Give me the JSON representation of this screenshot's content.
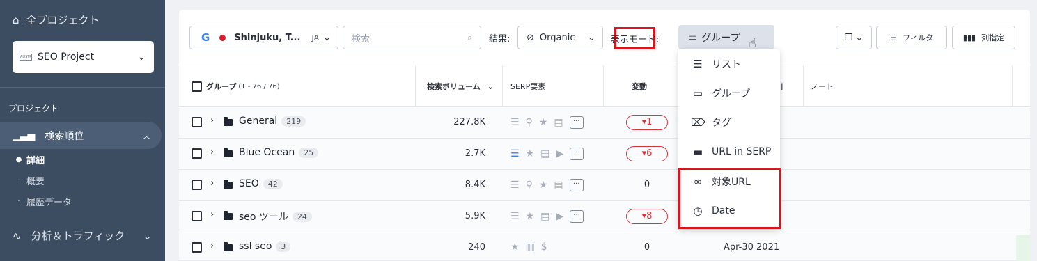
{
  "sidebar": {
    "all_projects": "全プロジェクト",
    "project_name": "SEO Project",
    "project_logo_text": "AUSTRO",
    "section_label": "プロジェクト",
    "active_item": "検索順位",
    "sub_items": [
      "詳細",
      "概要",
      "履歴データ"
    ],
    "bottom_item": "分析＆トラフィック"
  },
  "toolbar": {
    "location": "Shinjuku, T...",
    "language": "JA",
    "search_placeholder": "検索",
    "result_label": "結果:",
    "result_value": "Organic",
    "mode_label": "表示モード:",
    "mode_value": "グループ",
    "filter_label": "フィルタ",
    "columns_label": "列指定"
  },
  "table": {
    "headers": {
      "group": "グループ",
      "group_range": "(1 - 76 / 76)",
      "volume": "検索ボリューム",
      "serp": "SERP要素",
      "change": "変動",
      "notes": "ノート"
    },
    "rows": [
      {
        "name": "General",
        "count": "219",
        "volume": "227.8K",
        "change": "1",
        "date": ""
      },
      {
        "name": "Blue Ocean",
        "count": "25",
        "volume": "2.7K",
        "change": "6",
        "date": ""
      },
      {
        "name": "SEO",
        "count": "42",
        "volume": "8.4K",
        "change": "0",
        "date": ""
      },
      {
        "name": "seo ツール",
        "count": "24",
        "volume": "5.9K",
        "change": "8",
        "date": ""
      },
      {
        "name": "ssl seo",
        "count": "3",
        "volume": "240",
        "change": "0",
        "date": "Apr-30 2021"
      }
    ]
  },
  "dropdown": {
    "items": [
      "リスト",
      "グループ",
      "タグ",
      "URL in SERP",
      "対象URL",
      "Date"
    ]
  },
  "colors": {
    "sidebar_bg": "#3d4d61",
    "highlight_red": "#e0121b",
    "change_down": "#d8343a"
  }
}
